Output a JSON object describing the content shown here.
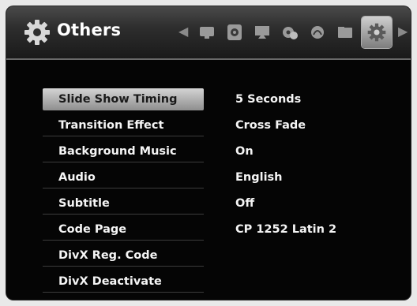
{
  "header": {
    "title": "Others",
    "title_icon": "gear-icon",
    "nav_icons": [
      "tv-screen-icon",
      "disc-icon",
      "monitor-icon",
      "settings-sub-icon",
      "speaker-icon",
      "folder-icon",
      "gear-icon"
    ],
    "active_nav_icon": "gear-icon"
  },
  "menu": {
    "items": [
      {
        "label": "Slide Show Timing",
        "value": "5 Seconds"
      },
      {
        "label": "Transition Effect",
        "value": "Cross Fade"
      },
      {
        "label": "Background Music",
        "value": "On"
      },
      {
        "label": "Audio",
        "value": "English"
      },
      {
        "label": "Subtitle",
        "value": "Off"
      },
      {
        "label": "Code Page",
        "value": "CP 1252 Latin 2"
      },
      {
        "label": "DivX Reg. Code",
        "value": ""
      },
      {
        "label": "DivX Deactivate",
        "value": ""
      }
    ],
    "selected_index": 0
  },
  "colors": {
    "background": "#050505",
    "text": "#f5f5f5",
    "highlight": "#bfbfbf"
  }
}
